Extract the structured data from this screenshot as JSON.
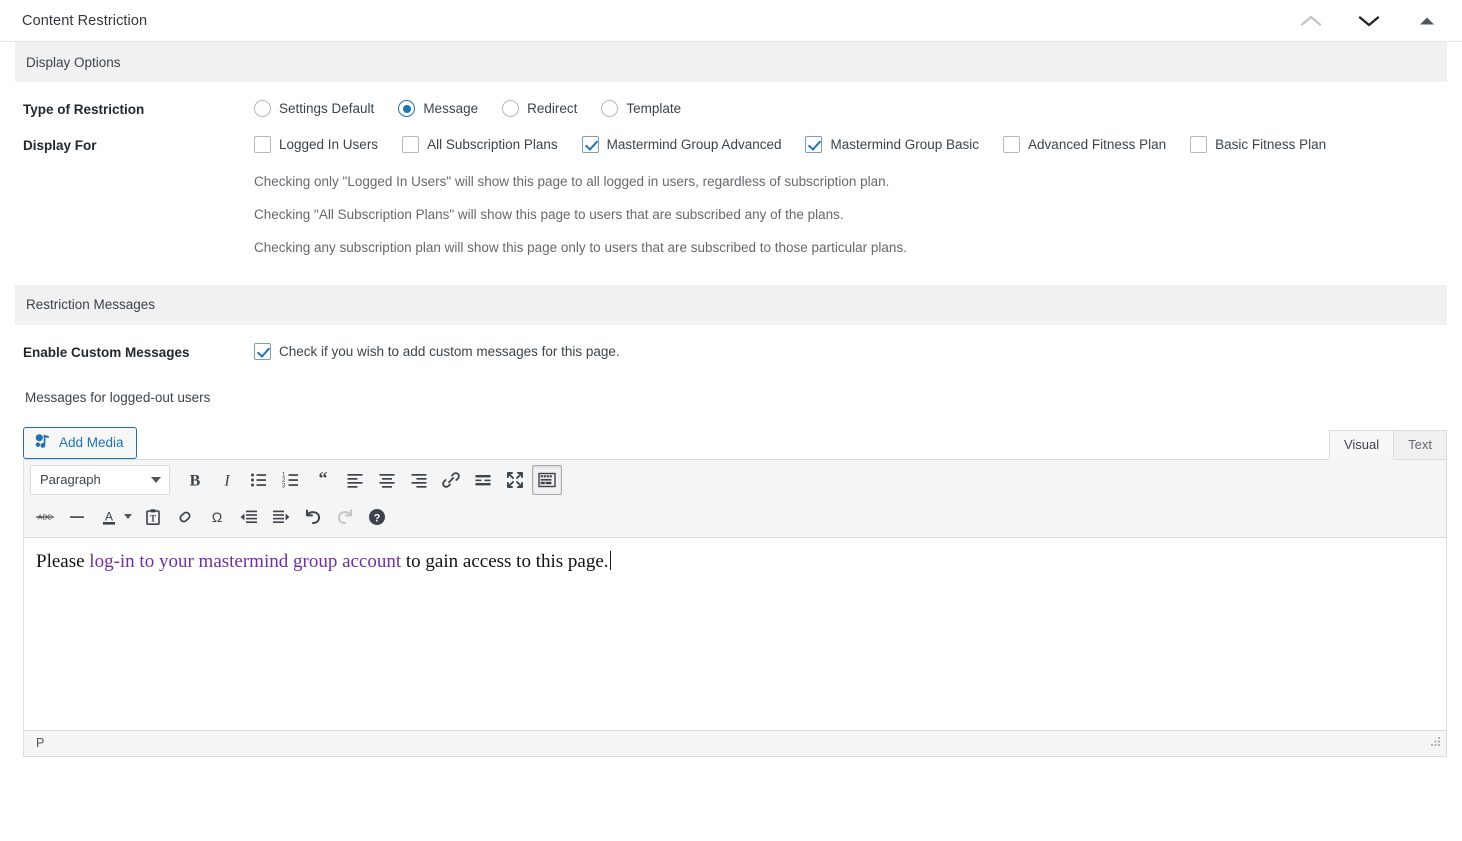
{
  "metabox": {
    "title": "Content Restriction",
    "handles": {
      "move_up": "move-up",
      "move_down": "move-down",
      "toggle": "toggle-panel"
    }
  },
  "sections": {
    "display_options": {
      "title": "Display Options"
    },
    "restriction_messages": {
      "title": "Restriction Messages"
    }
  },
  "type_of_restriction": {
    "label": "Type of Restriction",
    "options": [
      {
        "label": "Settings Default",
        "checked": false
      },
      {
        "label": "Message",
        "checked": true
      },
      {
        "label": "Redirect",
        "checked": false
      },
      {
        "label": "Template",
        "checked": false
      }
    ]
  },
  "display_for": {
    "label": "Display For",
    "options": [
      {
        "label": "Logged In Users",
        "checked": false
      },
      {
        "label": "All Subscription Plans",
        "checked": false
      },
      {
        "label": "Mastermind Group Advanced",
        "checked": true
      },
      {
        "label": "Mastermind Group Basic",
        "checked": true
      },
      {
        "label": "Advanced Fitness Plan",
        "checked": false
      },
      {
        "label": "Basic Fitness Plan",
        "checked": false
      }
    ],
    "help": [
      "Checking only \"Logged In Users\" will show this page to all logged in users, regardless of subscription plan.",
      "Checking \"All Subscription Plans\" will show this page to users that are subscribed any of the plans.",
      "Checking any subscription plan will show this page only to users that are subscribed to those particular plans."
    ]
  },
  "enable_custom_messages": {
    "label": "Enable Custom Messages",
    "checkbox_label": "Check if you wish to add custom messages for this page.",
    "checked": true
  },
  "editor": {
    "heading": "Messages for logged-out users",
    "add_media_label": "Add Media",
    "tabs": [
      {
        "label": "Visual",
        "active": true
      },
      {
        "label": "Text",
        "active": false
      }
    ],
    "format_select": "Paragraph",
    "toolbar_row1": [
      "bold-icon",
      "italic-icon",
      "bulleted-list-icon",
      "numbered-list-icon",
      "blockquote-icon",
      "align-left-icon",
      "align-center-icon",
      "align-right-icon",
      "link-icon",
      "read-more-icon",
      "fullscreen-icon",
      "toolbar-toggle-icon"
    ],
    "toolbar_row2": [
      "strikethrough-icon",
      "horizontal-rule-icon",
      "text-color-icon",
      "paste-as-text-icon",
      "clear-formatting-icon",
      "special-character-icon",
      "outdent-icon",
      "indent-icon",
      "undo-icon",
      "redo-icon",
      "help-icon"
    ],
    "content": {
      "before": "Please ",
      "link": "log-in to your mastermind group account",
      "after": " to gain access to this page."
    },
    "status_path": "P"
  },
  "colors": {
    "accent": "#1d74b8",
    "link_purple": "#7030a0",
    "section_bg": "#f1f1f1",
    "toolbar_bg": "#f5f5f5",
    "border": "#dcdcde"
  }
}
